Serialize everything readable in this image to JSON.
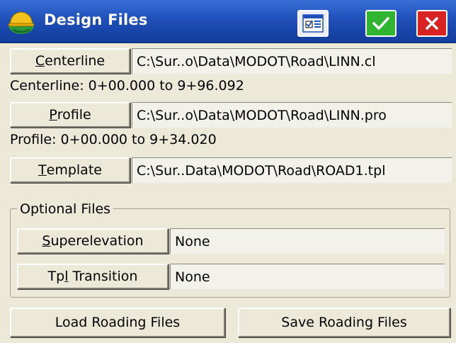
{
  "window": {
    "title": "Design Files"
  },
  "titlebar": {
    "grid_icon": "grid-dialog-icon",
    "ok_icon": "checkmark-icon",
    "close_icon": "close-x-icon",
    "colors": {
      "bar": "#1f4fb8",
      "ok": "#2fb52f",
      "close": "#d92222"
    }
  },
  "centerline": {
    "button_access": "C",
    "button_rest": "enterline",
    "path": "C:\\Sur..o\\Data\\MODOT\\Road\\LINN.cl",
    "range": "Centerline: 0+00.000 to 9+96.092"
  },
  "profile": {
    "button_access": "P",
    "button_rest": "rofile",
    "path": "C:\\Sur..o\\Data\\MODOT\\Road\\LINN.pro",
    "range": "Profile: 0+00.000 to 9+34.020"
  },
  "template": {
    "button_access": "T",
    "button_rest": "emplate",
    "path": "C:\\Sur..Data\\MODOT\\Road\\ROAD1.tpl"
  },
  "optional": {
    "group_label": "Optional Files",
    "superelevation": {
      "button_access": "S",
      "button_rest": "uperelevation",
      "value": "None"
    },
    "tpl_transition": {
      "button_pre": "Tp",
      "button_access": "l",
      "button_rest": " Transition",
      "value": "None"
    }
  },
  "footer": {
    "load_label": "Load Roading Files",
    "save_label": "Save Roading Files"
  }
}
